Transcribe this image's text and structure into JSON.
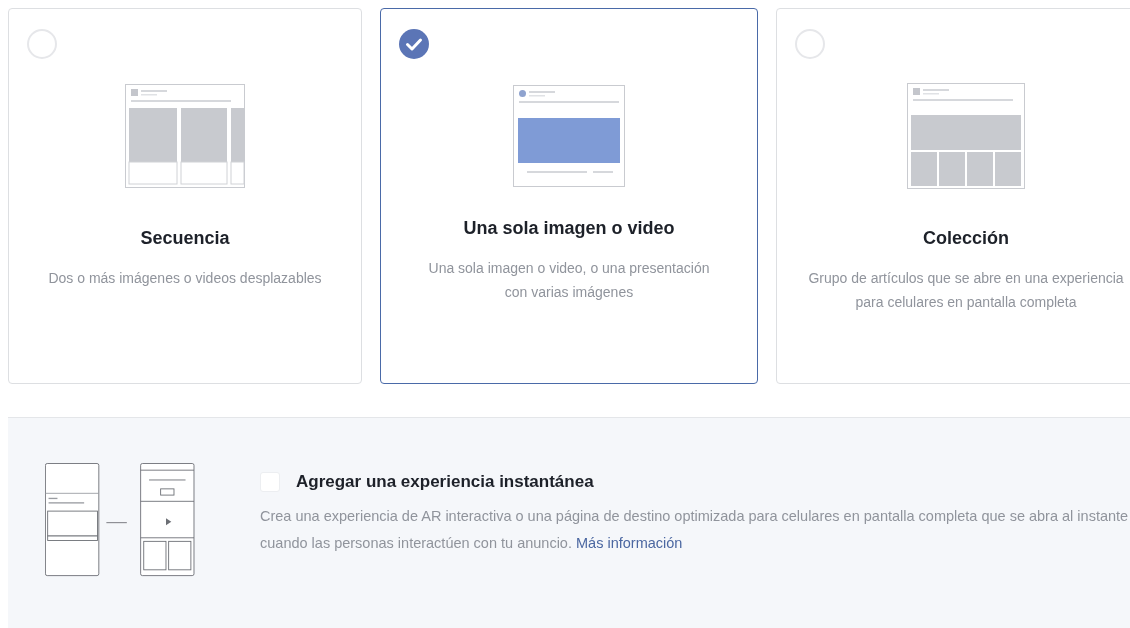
{
  "formats": [
    {
      "kind": "carousel",
      "title": "Secuencia",
      "description": "Dos o más imágenes o videos desplazables",
      "selected": false
    },
    {
      "kind": "single",
      "title": "Una sola imagen o video",
      "description": "Una sola imagen o video, o una presentación con varias imágenes",
      "selected": true
    },
    {
      "kind": "collection",
      "title": "Colección",
      "description": "Grupo de artículos que se abre en una experiencia para celulares en pantalla completa",
      "selected": false
    }
  ],
  "instant_experience": {
    "checked": false,
    "title": "Agregar una experiencia instantánea",
    "description": "Crea una experiencia de AR interactiva o una página de destino optimizada para celulares en pantalla completa que se abra al instante cuando las personas interactúen con tu anuncio.",
    "link": "Más información"
  }
}
